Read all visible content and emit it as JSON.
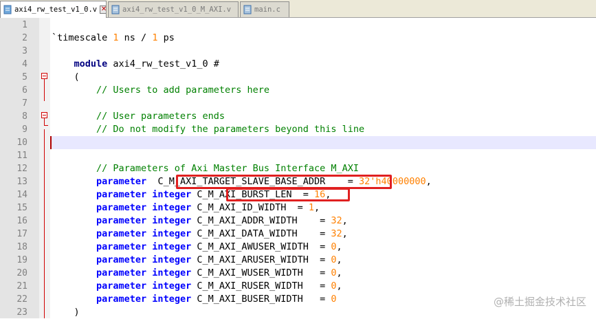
{
  "tabs": [
    {
      "label": "axi4_rw_test_v1_0.v",
      "active": true
    },
    {
      "label": "axi4_rw_test_v1_0_M_AXI.v",
      "active": false
    },
    {
      "label": "main.c",
      "active": false
    }
  ],
  "colors": {
    "keyword": "#0000ff",
    "comment": "#008000",
    "number": "#ff8000",
    "highlight_box": "#e02020"
  },
  "current_line": 10,
  "lines": [
    {
      "n": "1",
      "tokens": []
    },
    {
      "n": "2",
      "tokens": [
        [
          "plain",
          "`timescale "
        ],
        [
          "num",
          "1"
        ],
        [
          "plain",
          " ns / "
        ],
        [
          "num",
          "1"
        ],
        [
          "plain",
          " ps"
        ]
      ]
    },
    {
      "n": "3",
      "tokens": []
    },
    {
      "n": "4",
      "tokens": [
        [
          "plain",
          "    "
        ],
        [
          "kw2",
          "module"
        ],
        [
          "plain",
          " axi4_rw_test_v1_0 #"
        ]
      ]
    },
    {
      "n": "5",
      "tokens": [
        [
          "plain",
          "    ("
        ]
      ]
    },
    {
      "n": "6",
      "tokens": [
        [
          "cm",
          "        // Users to add parameters here"
        ]
      ]
    },
    {
      "n": "7",
      "tokens": []
    },
    {
      "n": "8",
      "tokens": [
        [
          "cm",
          "        // User parameters ends"
        ]
      ]
    },
    {
      "n": "9",
      "tokens": [
        [
          "cm",
          "        // Do not modify the parameters beyond this line"
        ]
      ]
    },
    {
      "n": "10",
      "tokens": []
    },
    {
      "n": "11",
      "tokens": []
    },
    {
      "n": "12",
      "tokens": [
        [
          "cm",
          "        // Parameters of Axi Master Bus Interface M_AXI"
        ]
      ]
    },
    {
      "n": "13",
      "tokens": [
        [
          "plain",
          "        "
        ],
        [
          "kw",
          "parameter"
        ],
        [
          "plain",
          "  C_M_AXI_TARGET_SLAVE_BASE_ADDR    = "
        ],
        [
          "num",
          "32'h40000000"
        ],
        [
          "plain",
          ","
        ]
      ]
    },
    {
      "n": "14",
      "tokens": [
        [
          "plain",
          "        "
        ],
        [
          "kw",
          "parameter integer"
        ],
        [
          "plain",
          " C_M_AXI_BURST_LEN  = "
        ],
        [
          "num",
          "16"
        ],
        [
          "plain",
          ","
        ]
      ]
    },
    {
      "n": "15",
      "tokens": [
        [
          "plain",
          "        "
        ],
        [
          "kw",
          "parameter integer"
        ],
        [
          "plain",
          " C_M_AXI_ID_WIDTH  = "
        ],
        [
          "num",
          "1"
        ],
        [
          "plain",
          ","
        ]
      ]
    },
    {
      "n": "16",
      "tokens": [
        [
          "plain",
          "        "
        ],
        [
          "kw",
          "parameter integer"
        ],
        [
          "plain",
          " C_M_AXI_ADDR_WIDTH    = "
        ],
        [
          "num",
          "32"
        ],
        [
          "plain",
          ","
        ]
      ]
    },
    {
      "n": "17",
      "tokens": [
        [
          "plain",
          "        "
        ],
        [
          "kw",
          "parameter integer"
        ],
        [
          "plain",
          " C_M_AXI_DATA_WIDTH    = "
        ],
        [
          "num",
          "32"
        ],
        [
          "plain",
          ","
        ]
      ]
    },
    {
      "n": "18",
      "tokens": [
        [
          "plain",
          "        "
        ],
        [
          "kw",
          "parameter integer"
        ],
        [
          "plain",
          " C_M_AXI_AWUSER_WIDTH  = "
        ],
        [
          "num",
          "0"
        ],
        [
          "plain",
          ","
        ]
      ]
    },
    {
      "n": "19",
      "tokens": [
        [
          "plain",
          "        "
        ],
        [
          "kw",
          "parameter integer"
        ],
        [
          "plain",
          " C_M_AXI_ARUSER_WIDTH  = "
        ],
        [
          "num",
          "0"
        ],
        [
          "plain",
          ","
        ]
      ]
    },
    {
      "n": "20",
      "tokens": [
        [
          "plain",
          "        "
        ],
        [
          "kw",
          "parameter integer"
        ],
        [
          "plain",
          " C_M_AXI_WUSER_WIDTH   = "
        ],
        [
          "num",
          "0"
        ],
        [
          "plain",
          ","
        ]
      ]
    },
    {
      "n": "21",
      "tokens": [
        [
          "plain",
          "        "
        ],
        [
          "kw",
          "parameter integer"
        ],
        [
          "plain",
          " C_M_AXI_RUSER_WIDTH   = "
        ],
        [
          "num",
          "0"
        ],
        [
          "plain",
          ","
        ]
      ]
    },
    {
      "n": "22",
      "tokens": [
        [
          "plain",
          "        "
        ],
        [
          "kw",
          "parameter integer"
        ],
        [
          "plain",
          " C_M_AXI_BUSER_WIDTH   = "
        ],
        [
          "num",
          "0"
        ]
      ]
    },
    {
      "n": "23",
      "tokens": [
        [
          "plain",
          "    )"
        ]
      ]
    }
  ],
  "watermark": "@稀土掘金技术社区"
}
